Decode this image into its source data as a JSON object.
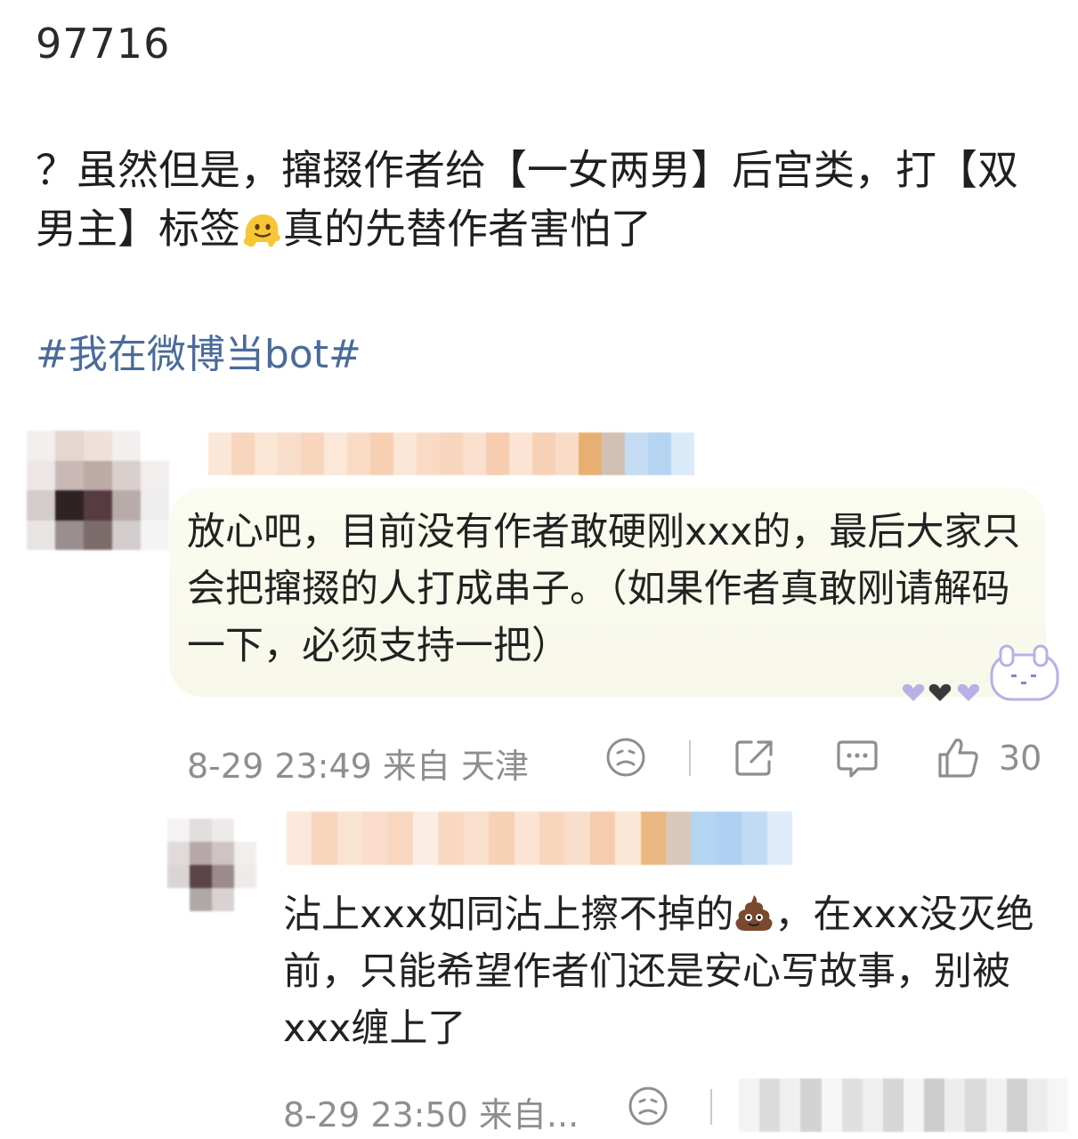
{
  "post": {
    "id_text": "97716",
    "body_part1": "？虽然但是，撺掇作者给【一女两男】后宫类，打【双男主】标签",
    "body_emoji": "melting-face-emoji",
    "body_part2": "真的先替作者害怕了",
    "hashtag": "#我在微博当bot#"
  },
  "comments": [
    {
      "text": "放心吧，目前没有作者敢硬刚xxx的，最后大家只会把撺掇的人打成串子。（如果作者真敢刚请解码一下，必须支持一把）",
      "meta": "8-29 23:49 来自 天津",
      "like_count": "30",
      "icons": [
        "sad-face-icon",
        "share-icon",
        "comment-icon",
        "thumbs-up-icon"
      ]
    },
    {
      "text_part1": "沾上xxx如同沾上擦不掉的",
      "emoji": "poop-emoji",
      "text_part2": "，在xxx没灭绝前，只能希望作者们还是安心写故事，别被xxx缠上了",
      "meta": "8-29 23:50 来自...",
      "icons": [
        "sad-face-icon"
      ]
    }
  ],
  "colors": {
    "hashtag": "#4a6b9a",
    "meta_text": "#8e8e8e",
    "bubble_bg": "#f8f9ec"
  }
}
